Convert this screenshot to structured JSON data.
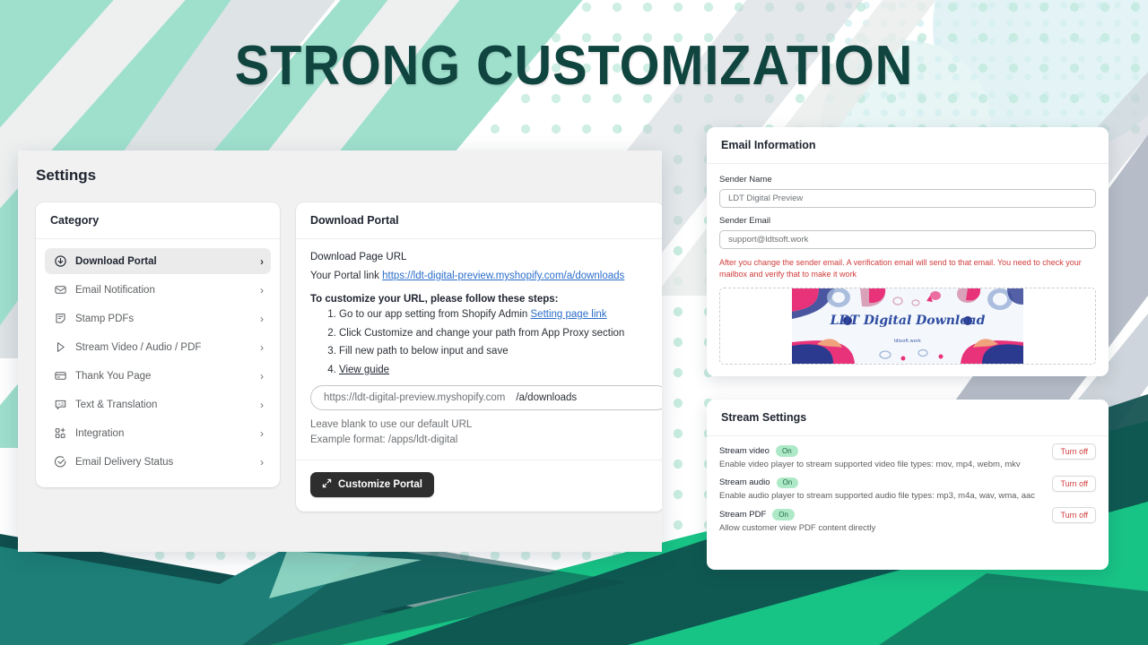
{
  "headline": "Strong Customization",
  "brand": {
    "mint": "#9fe0cd",
    "teal_dark": "#10443f",
    "teal": "#1d7f78",
    "green": "#18c386",
    "headline_color": "#10443f",
    "accent_link": "#2c6ecb",
    "warn_red": "#d13b3b",
    "badge_green_bg": "#aee9c7",
    "badge_green_text": "#1f6a45"
  },
  "settings_window": {
    "title": "Settings",
    "category_card": {
      "header": "Category",
      "items": [
        {
          "label": "Download Portal",
          "icon": "download-circle-icon",
          "active": true
        },
        {
          "label": "Email Notification",
          "icon": "envelope-icon",
          "active": false
        },
        {
          "label": "Stamp PDFs",
          "icon": "note-stamp-icon",
          "active": false
        },
        {
          "label": "Stream Video / Audio / PDF",
          "icon": "play-icon",
          "active": false
        },
        {
          "label": "Thank You Page",
          "icon": "card-icon",
          "active": false
        },
        {
          "label": "Text & Translation",
          "icon": "translate-icon",
          "active": false
        },
        {
          "label": "Integration",
          "icon": "grid-plus-icon",
          "active": false
        },
        {
          "label": "Email Delivery Status",
          "icon": "check-circle-icon",
          "active": false
        }
      ],
      "chevron": "›"
    },
    "detail_card": {
      "header": "Download Portal",
      "url_section_label": "Download Page URL",
      "portal_prefix": "Your Portal link",
      "portal_link": "https://ldt-digital-preview.myshopify.com/a/downloads",
      "steps_title": "To customize your URL, please follow these steps:",
      "steps": [
        {
          "text": "Go to our app setting from Shopify Admin ",
          "link": "Setting page link"
        },
        {
          "text": "Click Customize and change your path from App Proxy section",
          "link": ""
        },
        {
          "text": "Fill new path to below input and save",
          "link": ""
        },
        {
          "text": "",
          "link": "View guide"
        }
      ],
      "url_input_prefix": "https://ldt-digital-preview.myshopify.com",
      "url_input_value": "/a/downloads",
      "helper_1": "Leave blank to use our default URL",
      "helper_2": "Example format: /apps/ldt-digital",
      "customize_button": "Customize Portal",
      "customize_icon": "expand-arrows-icon"
    }
  },
  "email_card": {
    "header": "Email Information",
    "sender_name_label": "Sender Name",
    "sender_name_value": "LDT Digital Preview",
    "sender_email_label": "Sender Email",
    "sender_email_value": "support@ldtsoft.work",
    "warning": "After you change the sender email. A verification email will send to that email. You need to check your mailbox and verify that to make it work",
    "banner": {
      "title": "LDT Digital Download",
      "subtitle": "ldtsoft.work"
    }
  },
  "stream_card": {
    "header": "Stream Settings",
    "rows": [
      {
        "name": "Stream video",
        "status": "On",
        "description": "Enable video player to stream supported video file types: mov, mp4, webm, mkv",
        "action": "Turn off"
      },
      {
        "name": "Stream audio",
        "status": "On",
        "description": "Enable audio player to stream supported audio file types: mp3, m4a, wav, wma, aac",
        "action": "Turn off"
      },
      {
        "name": "Stream PDF",
        "status": "On",
        "description": "Allow customer view PDF content directly",
        "action": "Turn off"
      }
    ]
  }
}
